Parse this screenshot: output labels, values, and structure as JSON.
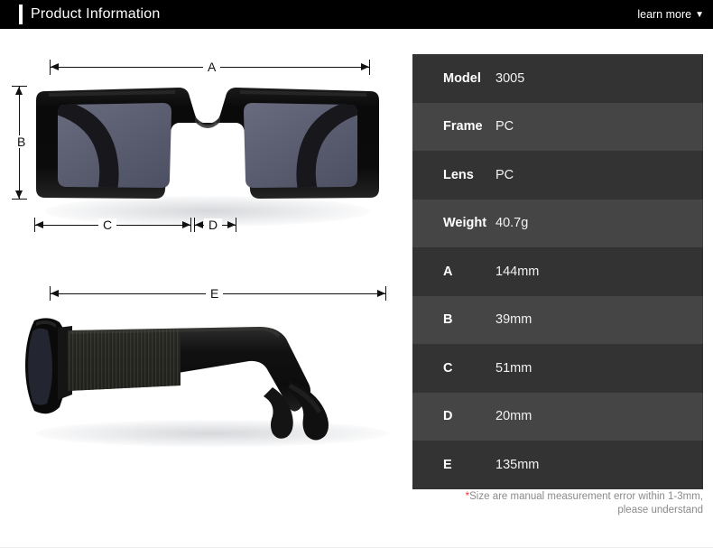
{
  "header": {
    "title": "Product Information",
    "learn_more_label": "learn more",
    "caret_glyph": "▼"
  },
  "spec_table": {
    "rows": [
      {
        "key": "Model",
        "value": "3005"
      },
      {
        "key": "Frame",
        "value": "PC"
      },
      {
        "key": "Lens",
        "value": "PC"
      },
      {
        "key": "Weight",
        "value": "40.7g"
      },
      {
        "key": "A",
        "value": "144mm"
      },
      {
        "key": "B",
        "value": "39mm"
      },
      {
        "key": "C",
        "value": "51mm"
      },
      {
        "key": "D",
        "value": "20mm"
      },
      {
        "key": "E",
        "value": "135mm"
      }
    ],
    "note_star": "*",
    "note_line1": "Size are manual measurement error within 1-3mm,",
    "note_line2": "please understand"
  },
  "diagram": {
    "labels": {
      "a": "A",
      "b": "B",
      "c": "C",
      "d": "D",
      "e": "E"
    }
  },
  "colors": {
    "header_bg": "#000000",
    "row_dark": "#333333",
    "row_light": "#454545",
    "note_red": "#e8372a",
    "frame_black": "#0c0c0c",
    "lens_gray": "#5b5e70"
  }
}
